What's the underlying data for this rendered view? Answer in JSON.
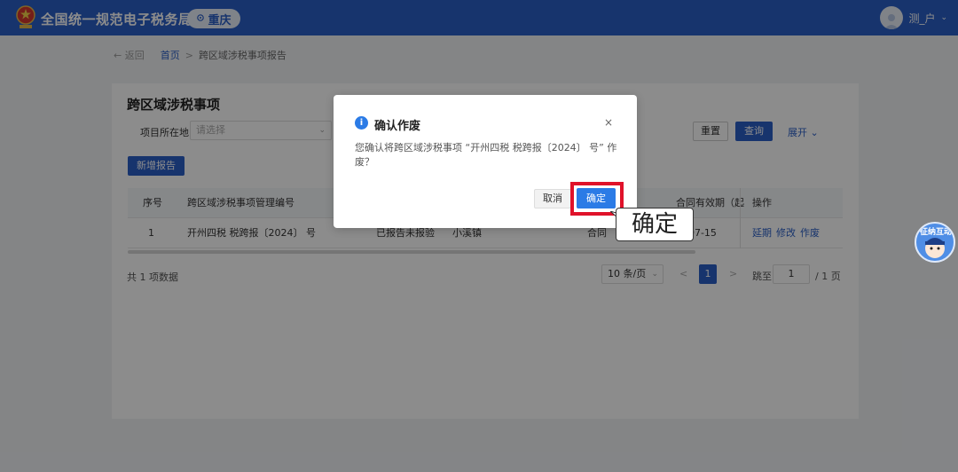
{
  "header": {
    "site_title": "全国统一规范电子税务局",
    "region": "重庆",
    "user_name": "测_户"
  },
  "breadcrumb": {
    "back": "← 返回",
    "home": "首页",
    "separator": ">",
    "current": "跨区域涉税事项报告"
  },
  "card": {
    "title": "跨区域涉税事项",
    "filter_label": "项目所在地",
    "filter_placeholder": "请选择",
    "reset_label": "重置",
    "query_label": "查询",
    "expand_label": "展开 ⌄",
    "add_label": "新增报告"
  },
  "table": {
    "columns": [
      "序号",
      "跨区域涉税事项管理编号",
      "合同有效期（起",
      "操作"
    ],
    "rows": [
      {
        "index": "1",
        "code": "开州四税 税跨报〔2024〕  号",
        "status": "已报告未报验",
        "town": "小溪镇",
        "contract": "合同",
        "valid_end": "-07-15",
        "actions": [
          "延期",
          "修改",
          "作废"
        ]
      }
    ]
  },
  "pagination": {
    "total": "共 1 项数据",
    "page_size": "10 条/页",
    "prev": "<",
    "current_page": "1",
    "next": ">",
    "jump_label": "跳至",
    "jump_value": "1",
    "total_pages": "/ 1 页"
  },
  "dialog": {
    "title": "确认作废",
    "close": "×",
    "message": "您确认将跨区域涉税事项 “开州四税 税跨报〔2024〕   号” 作废？",
    "cancel_label": "取消",
    "ok_label": "确定"
  },
  "callout": {
    "text": "确定"
  },
  "assistant": {
    "label": "征纳互动"
  },
  "colors": {
    "primary": "#2b5fc6",
    "dialog_button": "#2b7be6",
    "highlight": "#e0122a"
  }
}
